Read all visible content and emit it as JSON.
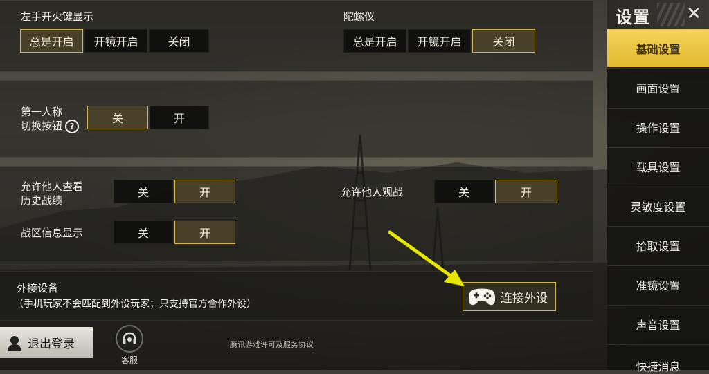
{
  "left_fire": {
    "label": "左手开火键显示",
    "options": [
      "总是开启",
      "开镜开启",
      "关闭"
    ],
    "selected": "总是开启"
  },
  "gyro": {
    "label": "陀螺仪",
    "options": [
      "总是开启",
      "开镜开启",
      "关闭"
    ],
    "selected": "关闭"
  },
  "first_person": {
    "label_line1": "第一人称",
    "label_line2": "切换按钮",
    "help_icon": "question-icon",
    "options": [
      "关",
      "开"
    ],
    "selected": "关"
  },
  "allow_history": {
    "label_line1": "允许他人查看",
    "label_line2": "历史战绩",
    "options": [
      "关",
      "开"
    ],
    "selected": "开"
  },
  "allow_spectate": {
    "label": "允许他人观战",
    "options": [
      "关",
      "开"
    ],
    "selected": "开"
  },
  "zone_info": {
    "label": "战区信息显示",
    "options": [
      "关",
      "开"
    ],
    "selected": "开"
  },
  "external": {
    "title": "外接设备",
    "note": "（手机玩家不会匹配到外设玩家；只支持官方合作外设）",
    "connect_label": "连接外设",
    "connect_icon": "gamepad-icon"
  },
  "sidebar": {
    "title": "设置",
    "close_icon": "close-icon",
    "items": [
      {
        "label": "基础设置",
        "active": true
      },
      {
        "label": "画面设置",
        "active": false
      },
      {
        "label": "操作设置",
        "active": false
      },
      {
        "label": "载具设置",
        "active": false
      },
      {
        "label": "灵敏度设置",
        "active": false
      },
      {
        "label": "拾取设置",
        "active": false
      },
      {
        "label": "准镜设置",
        "active": false
      },
      {
        "label": "声音设置",
        "active": false
      },
      {
        "label": "快捷消息",
        "active": false
      }
    ]
  },
  "footer": {
    "logout_label": "退出登录",
    "customer_service_label": "客服",
    "agreement_link": "腾讯游戏许可及服务协议"
  },
  "colors": {
    "accent": "#d6b54a",
    "active_menu": "#f0cc4c",
    "annotation_arrow": "#e6e600"
  }
}
